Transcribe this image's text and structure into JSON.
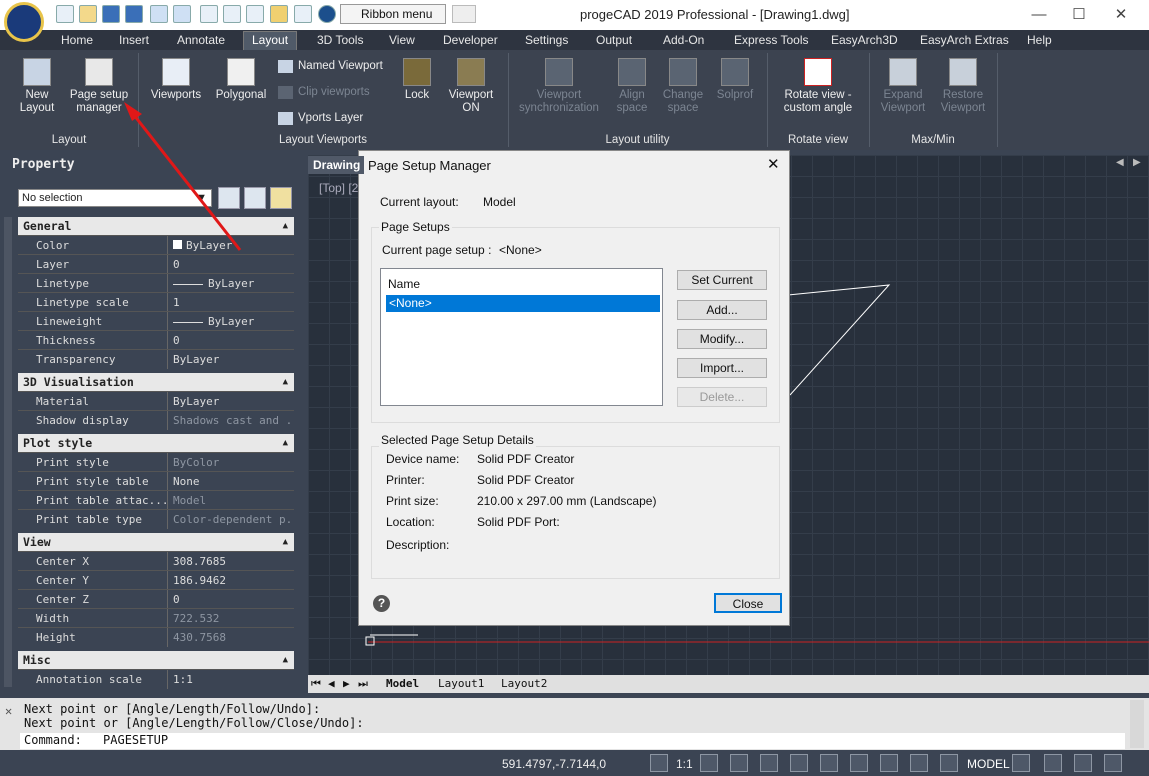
{
  "app_title": "progeCAD 2019 Professional - [Drawing1.dwg]",
  "quick_access": {
    "dropdown_label": "Ribbon menu"
  },
  "menu": {
    "items": [
      "Home",
      "Insert",
      "Annotate",
      "Layout",
      "3D Tools",
      "View",
      "Developer",
      "Settings",
      "Output",
      "Add-On",
      "Express Tools",
      "EasyArch3D",
      "EasyArch Extras",
      "Help"
    ]
  },
  "ribbon": {
    "new_layout": "New\nLayout",
    "page_setup": "Page setup\nmanager",
    "viewports": "Viewports",
    "polygonal": "Polygonal",
    "named_viewport": "Named Viewport",
    "clip_viewports": "Clip viewports",
    "vports_layer": "Vports Layer",
    "lock": "Lock",
    "viewport_on": "Viewport\nON",
    "viewport_sync": "Viewport\nsynchronization",
    "align_space": "Align\nspace",
    "change_space": "Change\nspace",
    "solprof": "Solprof",
    "rotate_view": "Rotate view -\ncustom angle",
    "expand_viewport": "Expand\nViewport",
    "restore_viewport": "Restore\nViewport",
    "panels": {
      "layout": "Layout",
      "layout_viewports": "Layout Viewports",
      "layout_utility": "Layout utility",
      "rotate_view": "Rotate view",
      "max_min": "Max/Min"
    }
  },
  "property": {
    "title": "Property",
    "selection": "No selection",
    "general": {
      "title": "General",
      "rows": [
        [
          "Color",
          "ByLayer"
        ],
        [
          "Layer",
          "0"
        ],
        [
          "Linetype",
          "ByLayer"
        ],
        [
          "Linetype scale",
          "1"
        ],
        [
          "Lineweight",
          "ByLayer"
        ],
        [
          "Thickness",
          "0"
        ],
        [
          "Transparency",
          "ByLayer"
        ]
      ]
    },
    "visualisation": {
      "title": "3D Visualisation",
      "rows": [
        [
          "Material",
          "ByLayer"
        ],
        [
          "Shadow display",
          "Shadows cast and ..."
        ]
      ]
    },
    "plot_style": {
      "title": "Plot style",
      "rows": [
        [
          "Print style",
          "ByColor"
        ],
        [
          "Print style table",
          "None"
        ],
        [
          "Print table attac...",
          "Model"
        ],
        [
          "Print table type",
          "Color-dependent p..."
        ]
      ]
    },
    "view": {
      "title": "View",
      "rows": [
        [
          "Center X",
          "308.7685"
        ],
        [
          "Center Y",
          "186.9462"
        ],
        [
          "Center Z",
          "0"
        ],
        [
          "Width",
          "722.532"
        ],
        [
          "Height",
          "430.7568"
        ]
      ]
    },
    "misc": {
      "title": "Misc",
      "rows": [
        [
          "Annotation scale",
          "1:1"
        ]
      ]
    }
  },
  "drawing": {
    "tab_label": "Drawing",
    "view_label": "[Top] [2"
  },
  "layout_tabs": [
    "Model",
    "Layout1",
    "Layout2"
  ],
  "dialog": {
    "title": "Page Setup Manager",
    "current_layout_label": "Current layout:",
    "current_layout_value": "Model",
    "page_setups_label": "Page Setups",
    "current_page_setup_label": "Current page setup :",
    "current_page_setup_value": "<None>",
    "list_header": "Name",
    "list_items": [
      "<None>"
    ],
    "buttons": {
      "set_current": "Set Current",
      "add": "Add...",
      "modify": "Modify...",
      "import": "Import...",
      "delete": "Delete...",
      "close": "Close"
    },
    "details_label": "Selected Page Setup Details",
    "details": [
      [
        "Device name:",
        "Solid PDF Creator"
      ],
      [
        "Printer:",
        "Solid PDF Creator"
      ],
      [
        "Print size:",
        "210.00 x 297.00 mm (Landscape)"
      ],
      [
        "Location:",
        "Solid PDF Port:"
      ],
      [
        "Description:",
        ""
      ]
    ]
  },
  "command_line": {
    "lines": [
      "Next point or [Angle/Length/Follow/Undo]:",
      "Next point or [Angle/Length/Follow/Close/Undo]:"
    ],
    "prompt": "Command:",
    "current": "PAGESETUP"
  },
  "status": {
    "coords": "591.4797,-7.7144,0",
    "scale": "1:1",
    "mode": "MODEL"
  }
}
